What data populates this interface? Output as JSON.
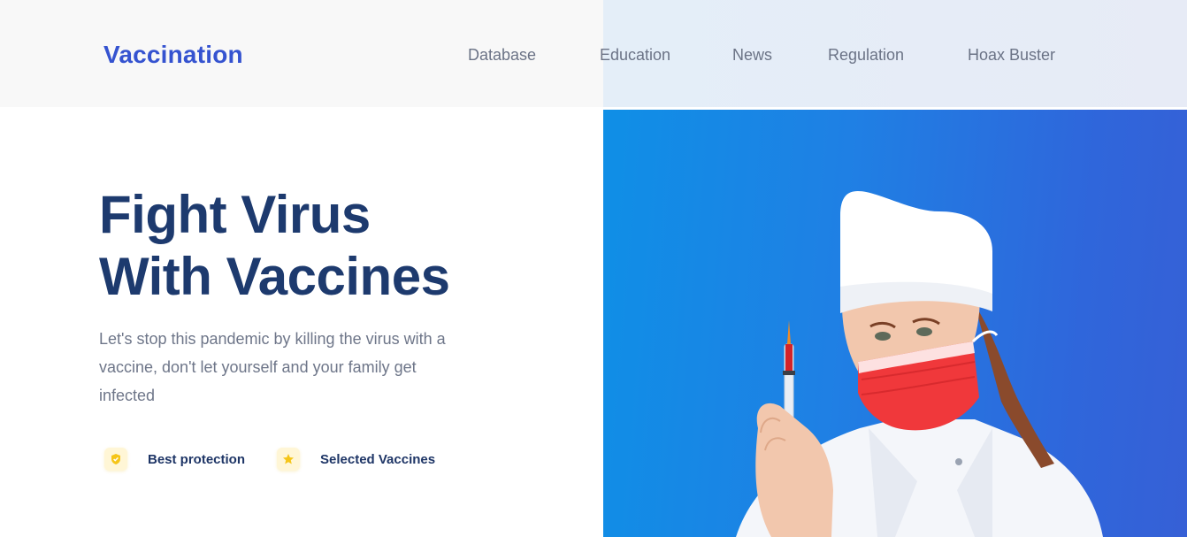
{
  "brand": {
    "name": "Vaccination",
    "color": "#3553d0"
  },
  "nav": {
    "items": [
      {
        "label": "Database"
      },
      {
        "label": "Education"
      },
      {
        "label": "News"
      },
      {
        "label": "Regulation"
      },
      {
        "label": "Hoax Buster"
      }
    ]
  },
  "hero": {
    "title_line1": "Fight Virus",
    "title_line2": "With Vaccines",
    "description": "Let's stop this pandemic by killing the virus with a vaccine, don't let yourself and your family get infected",
    "features": [
      {
        "icon": "shield-icon",
        "label": "Best protection"
      },
      {
        "icon": "star-icon",
        "label": "Selected Vaccines"
      }
    ],
    "image": {
      "subject": "nurse-with-syringe",
      "background_color": "#1f80e4"
    }
  },
  "colors": {
    "title": "#1d3a6e",
    "text": "#6e7689",
    "accent_yellow": "#f5c518"
  }
}
